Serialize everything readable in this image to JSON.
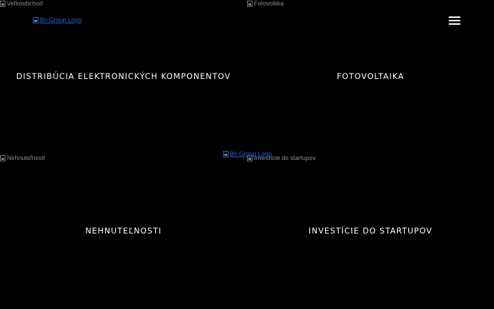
{
  "header": {
    "logo_alt": "Bri Group Logo",
    "menu_icon": "hamburger-menu-icon"
  },
  "center_logo": {
    "alt": "Bri Group Logo"
  },
  "tiles": [
    {
      "image_alt": "Veľkoobchod",
      "title": "DISTRIBÚCIA ELEKTRONICKÝCH KOMPONENTOV"
    },
    {
      "image_alt": "Fotovoltika",
      "title": "FOTOVOLTAIKA"
    },
    {
      "image_alt": "Nehnuteľnosti",
      "title": "NEHNUTEĽNOSTI"
    },
    {
      "image_alt": "Investície do startupov",
      "title": "INVESTÍCIE DO STARTUPOV"
    }
  ],
  "colors": {
    "background": "#000000",
    "text": "#ffffff",
    "link": "#2b5fd9",
    "alt_text": "#8a8a8a"
  }
}
